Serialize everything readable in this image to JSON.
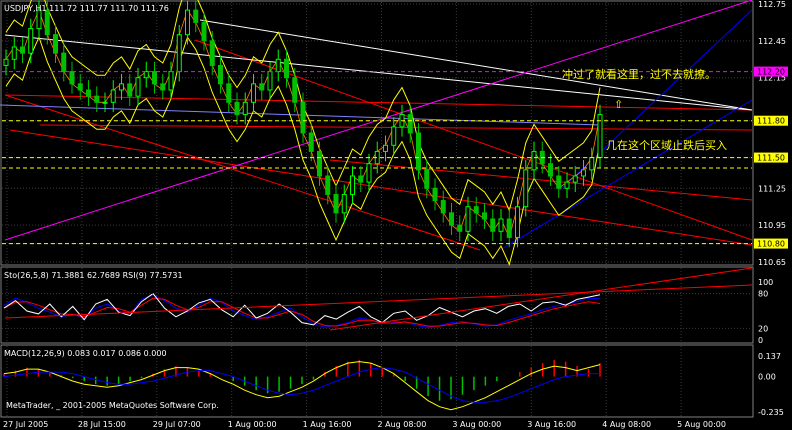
{
  "colors": {
    "background": "#000000",
    "grid": "#3a3a3a",
    "bull": "#00ff00",
    "bear": "#00c000",
    "bands": "#ffff00",
    "trend_red": "#ff0000",
    "trend_magenta": "#ff00ff",
    "trend_white": "#ffffff",
    "trend_blue": "#0000ff",
    "ma_orange": "#ff8000",
    "ma_lightblue": "#8080ff",
    "sto_main": "#0000ff",
    "sto_signal": "#ff0000",
    "rsi": "#ffffff",
    "macd_line": "#ffff00",
    "macd_signal": "#0000ff",
    "macd_hist_up": "#ff0000",
    "macd_hist_down": "#00c000"
  },
  "header": {
    "symbol_line": "USDJPY,H1  111.72 111.77 111.70 111.76",
    "sto_line": "Sto(26,5,8) 71.3881 62.7689  RSI(9) 77.5731",
    "macd_line": "MACD(12,26,9) 0.083 0.017 0.086 0.000",
    "copyright": "MetaTrader, _ 2001-2005 MetaQuotes Software Corp."
  },
  "annotations": {
    "upper_note": "冲过了就看这里，过不去就撩。",
    "lower_note": "几在这个区域止跌后买入",
    "arrow_glyph": "⇧"
  },
  "chart_data": [
    {
      "type": "candlestick",
      "title": "USDJPY,H1",
      "ylim": [
        110.65,
        112.75
      ],
      "price_ticks": [
        "112.75",
        "112.45",
        "112.15",
        "111.80",
        "111.50",
        "111.25",
        "110.95",
        "110.80",
        "110.65"
      ],
      "highlighted_prices": [
        {
          "value": "112.20",
          "color": "#ff00ff"
        },
        {
          "value": "111.80",
          "color": "#ffff00"
        },
        {
          "value": "111.50",
          "color": "#ffff00"
        },
        {
          "value": "110.80",
          "color": "#ffff00"
        }
      ],
      "x_ticks": [
        "27 Jul 2005",
        "28 Jul 15:00",
        "29 Jul 07:00",
        "1 Aug 00:00",
        "1 Aug 16:00",
        "2 Aug 08:00",
        "3 Aug 00:00",
        "3 Aug 16:00",
        "4 Aug 08:00",
        "5 Aug 00:00"
      ],
      "close_path": [
        112.3,
        112.4,
        112.35,
        112.55,
        112.7,
        112.5,
        112.35,
        112.2,
        112.1,
        112.05,
        112.0,
        111.95,
        111.95,
        112.05,
        112.1,
        112.0,
        112.15,
        112.2,
        112.1,
        112.05,
        112.2,
        112.5,
        112.7,
        112.6,
        112.45,
        112.25,
        112.1,
        111.95,
        111.85,
        111.95,
        112.1,
        112.05,
        112.2,
        112.3,
        112.15,
        111.95,
        111.7,
        111.55,
        111.35,
        111.2,
        111.05,
        111.2,
        111.35,
        111.3,
        111.45,
        111.55,
        111.6,
        111.75,
        111.85,
        111.7,
        111.4,
        111.25,
        111.15,
        111.05,
        110.95,
        110.9,
        111.1,
        111.05,
        111.0,
        110.9,
        111.0,
        110.85,
        111.1,
        111.4,
        111.55,
        111.45,
        111.35,
        111.25,
        111.3,
        111.35,
        111.4,
        111.5,
        111.85
      ],
      "last": {
        "open": 111.72,
        "high": 111.77,
        "low": 111.7,
        "close": 111.76
      }
    },
    {
      "type": "line",
      "title": "Sto(26,5,8) RSI(9)",
      "ylim": [
        0,
        100
      ],
      "y_ticks": [
        "100",
        "80",
        "20",
        "0"
      ],
      "series": [
        {
          "name": "Sto main",
          "values": [
            60,
            72,
            65,
            55,
            48,
            40,
            45,
            38,
            55,
            62,
            50,
            45,
            70,
            78,
            68,
            55,
            48,
            60,
            72,
            65,
            50,
            42,
            35,
            40,
            48,
            55,
            40,
            28,
            22,
            25,
            30,
            38,
            35,
            28,
            30,
            32,
            25,
            22,
            25,
            30,
            32,
            28,
            24,
            26,
            34,
            40,
            45,
            52,
            58,
            62,
            66,
            72,
            71
          ]
        },
        {
          "name": "Sto signal",
          "values": [
            55,
            65,
            66,
            60,
            52,
            45,
            44,
            40,
            48,
            56,
            54,
            48,
            60,
            72,
            70,
            60,
            52,
            56,
            66,
            66,
            56,
            46,
            38,
            38,
            44,
            50,
            44,
            32,
            25,
            24,
            28,
            34,
            34,
            30,
            29,
            31,
            28,
            24,
            24,
            27,
            30,
            29,
            26,
            25,
            30,
            36,
            42,
            48,
            54,
            58,
            62,
            66,
            63
          ]
        },
        {
          "name": "RSI",
          "values": [
            55,
            68,
            50,
            45,
            62,
            40,
            58,
            35,
            62,
            70,
            48,
            42,
            66,
            80,
            55,
            40,
            50,
            64,
            70,
            52,
            40,
            60,
            38,
            46,
            62,
            48,
            30,
            26,
            42,
            36,
            48,
            58,
            40,
            30,
            46,
            50,
            34,
            42,
            56,
            48,
            40,
            50,
            54,
            46,
            58,
            62,
            50,
            64,
            66,
            60,
            70,
            74,
            78
          ]
        }
      ]
    },
    {
      "type": "bar",
      "title": "MACD(12,26,9)",
      "ylim": [
        -0.235,
        0.137
      ],
      "y_ticks": [
        "0.137",
        "0.00",
        "-0.235"
      ],
      "histogram": [
        0.02,
        0.04,
        0.06,
        0.05,
        0.03,
        0.01,
        -0.01,
        -0.03,
        -0.05,
        -0.06,
        -0.05,
        -0.03,
        -0.01,
        0.02,
        0.05,
        0.07,
        0.06,
        0.04,
        0.02,
        0.0,
        -0.03,
        -0.06,
        -0.09,
        -0.11,
        -0.1,
        -0.08,
        -0.05,
        -0.02,
        0.03,
        0.07,
        0.1,
        0.11,
        0.09,
        0.06,
        0.02,
        -0.03,
        -0.08,
        -0.13,
        -0.16,
        -0.15,
        -0.12,
        -0.09,
        -0.06,
        -0.03,
        0.0,
        0.03,
        0.06,
        0.09,
        0.11,
        0.1,
        0.07,
        0.05,
        0.09
      ],
      "series": [
        {
          "name": "MACD",
          "values": [
            0.02,
            0.03,
            0.05,
            0.05,
            0.03,
            0.0,
            -0.03,
            -0.05,
            -0.06,
            -0.07,
            -0.06,
            -0.04,
            -0.02,
            0.01,
            0.04,
            0.06,
            0.06,
            0.05,
            0.02,
            -0.02,
            -0.05,
            -0.09,
            -0.12,
            -0.14,
            -0.13,
            -0.1,
            -0.07,
            -0.03,
            0.02,
            0.06,
            0.09,
            0.1,
            0.09,
            0.06,
            0.02,
            -0.04,
            -0.1,
            -0.16,
            -0.2,
            -0.22,
            -0.2,
            -0.17,
            -0.14,
            -0.1,
            -0.06,
            -0.02,
            0.02,
            0.05,
            0.07,
            0.06,
            0.04,
            0.06,
            0.08
          ]
        },
        {
          "name": "Signal",
          "values": [
            0.0,
            0.01,
            0.02,
            0.03,
            0.03,
            0.03,
            0.02,
            0.0,
            -0.02,
            -0.04,
            -0.05,
            -0.05,
            -0.04,
            -0.03,
            -0.01,
            0.01,
            0.03,
            0.04,
            0.04,
            0.02,
            0.0,
            -0.03,
            -0.06,
            -0.09,
            -0.11,
            -0.12,
            -0.11,
            -0.09,
            -0.06,
            -0.03,
            0.0,
            0.03,
            0.05,
            0.06,
            0.05,
            0.03,
            -0.01,
            -0.05,
            -0.09,
            -0.13,
            -0.16,
            -0.17,
            -0.17,
            -0.16,
            -0.14,
            -0.11,
            -0.08,
            -0.05,
            -0.02,
            0.0,
            0.01,
            0.02,
            0.02
          ]
        }
      ]
    }
  ]
}
